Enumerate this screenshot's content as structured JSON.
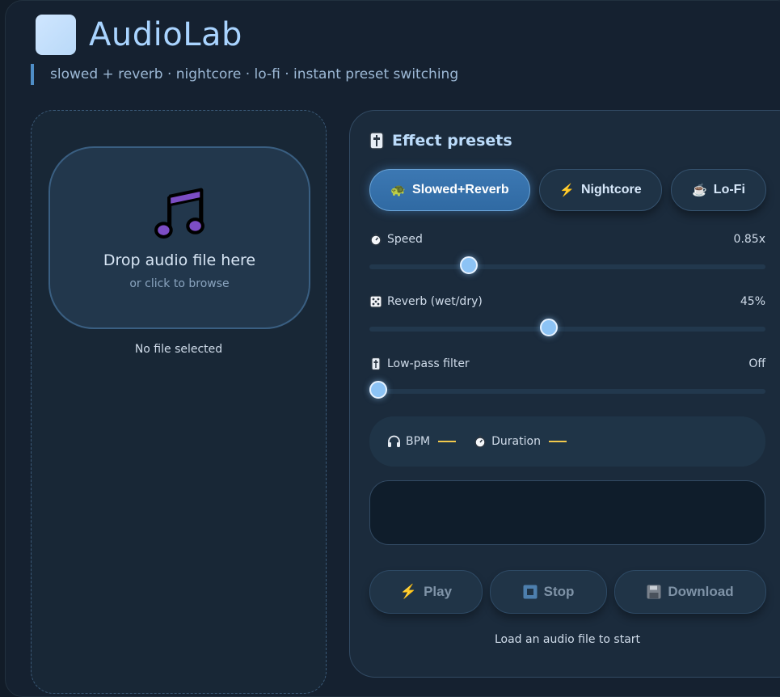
{
  "app": {
    "title": "AudioLab",
    "tagline": "slowed + reverb · nightcore · lo-fi · instant preset switching"
  },
  "upload": {
    "drop_title": "Drop audio file here",
    "drop_subtitle": "or click to browse",
    "file_status": "No file selected",
    "icon": "music-note-icon"
  },
  "presets": {
    "header": "Effect presets",
    "header_icon": "sliders-icon",
    "items": [
      {
        "label": "Slowed+Reverb",
        "icon": "turtle-icon",
        "active": true
      },
      {
        "label": "Nightcore",
        "icon": "lightning-icon",
        "active": false
      },
      {
        "label": "Lo-Fi",
        "icon": "coffee-icon",
        "active": false
      }
    ]
  },
  "controls": {
    "speed": {
      "label": "Speed",
      "value_text": "0.85x",
      "fraction": 0.24,
      "icon": "timer-icon"
    },
    "reverb": {
      "label": "Reverb (wet/dry)",
      "value_text": "45%",
      "fraction": 0.45,
      "icon": "dice-icon"
    },
    "lowpass": {
      "label": "Low-pass filter",
      "value_text": "Off",
      "fraction": 0.0,
      "icon": "sliders-icon"
    }
  },
  "stats": {
    "bpm_label": "BPM",
    "duration_label": "Duration"
  },
  "actions": {
    "play": "Play",
    "stop": "Stop",
    "download": "Download"
  },
  "status": "Load an audio file to start",
  "colors": {
    "accent": "#3c78b3",
    "thumb": "#8cc3f5",
    "stat_dash": "#f2c94c",
    "icon_purple": "#7c4dc4"
  }
}
